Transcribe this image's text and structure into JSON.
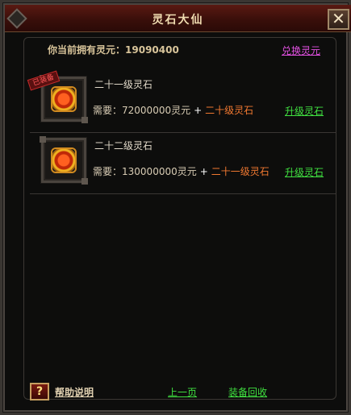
{
  "window": {
    "title": "灵石大仙",
    "close_icon": "✕"
  },
  "header": {
    "balance_label": "你当前拥有灵元：",
    "balance_value": "19090400",
    "exchange_link": "兑换灵元"
  },
  "items": [
    {
      "name": "二十一级灵石",
      "stamp": "已装备",
      "need_label": "需要：",
      "need_amount": "72000000灵元",
      "plus": "+",
      "need_item": "二十级灵石",
      "upgrade_link": "升级灵石",
      "icon": "spirit-stone-icon"
    },
    {
      "name": "二十二级灵石",
      "need_label": "需要：",
      "need_amount": "130000000灵元",
      "plus": "+",
      "need_item": "二十一级灵石",
      "upgrade_link": "升级灵石",
      "icon": "spirit-stone-icon"
    }
  ],
  "footer": {
    "help_icon": "?",
    "help_label": "帮助说明",
    "prev_page": "上一页",
    "equipment_recycle": "装备回收"
  },
  "colors": {
    "link_green": "#40e040",
    "link_purple": "#e050e0",
    "title_bar": "#5a1a12"
  }
}
